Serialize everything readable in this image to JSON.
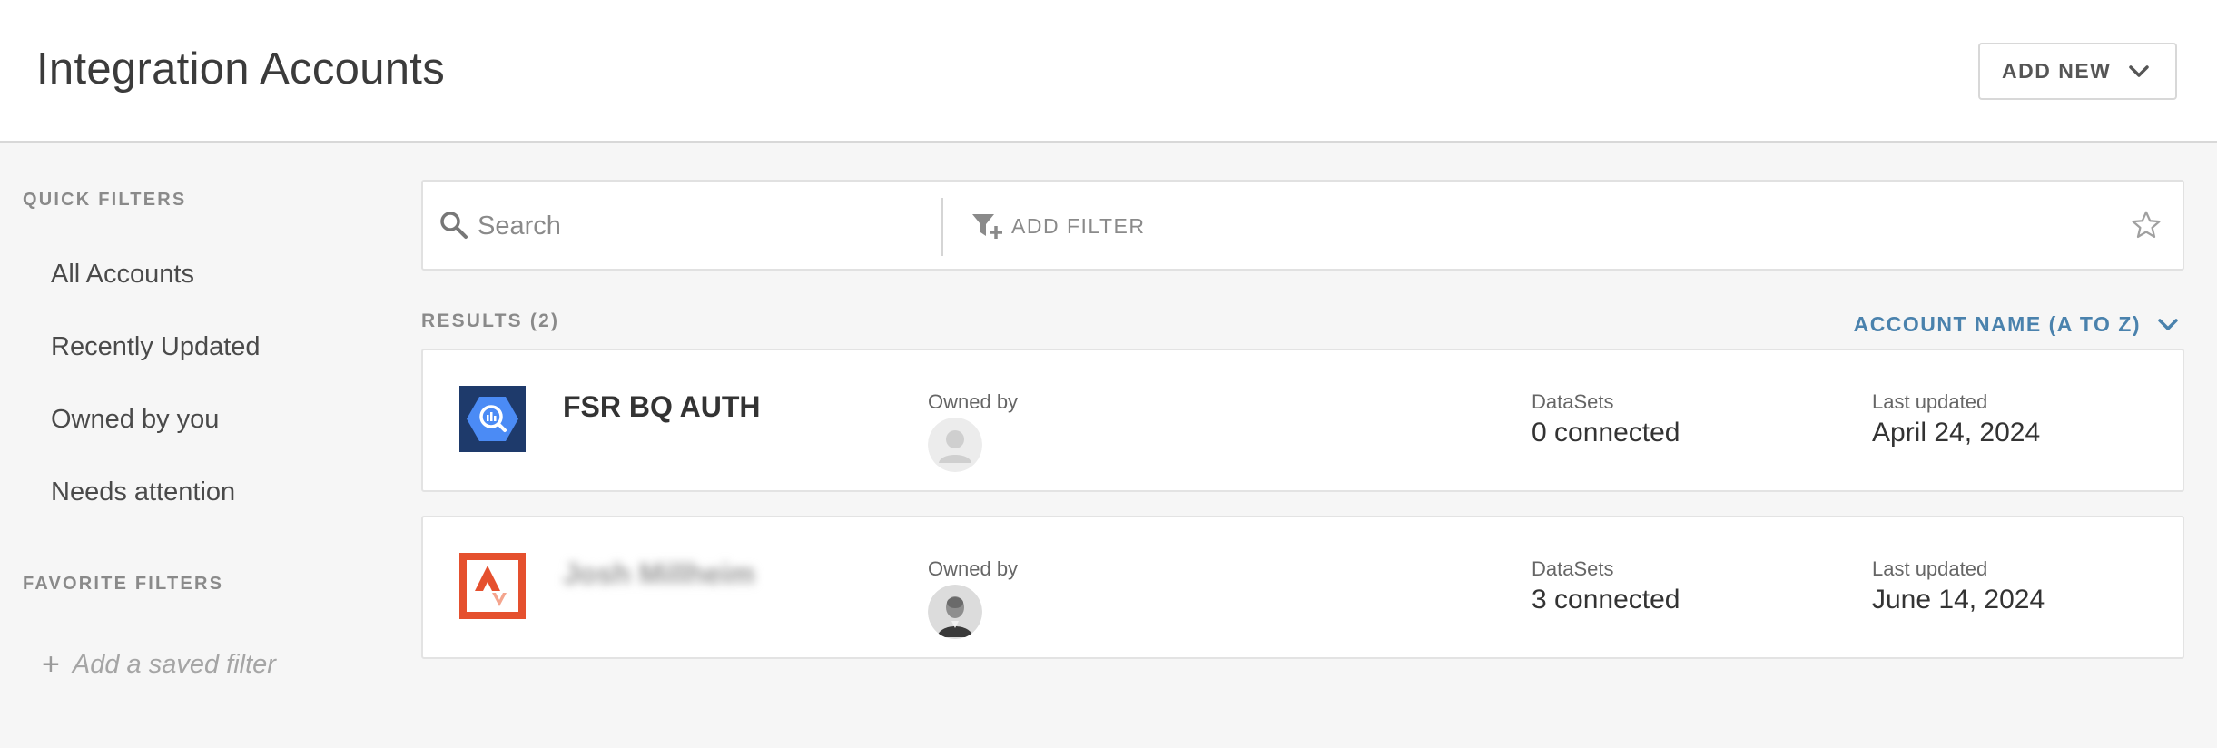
{
  "header": {
    "title": "Integration Accounts",
    "add_new_label": "ADD NEW"
  },
  "sidebar": {
    "quick_filters_label": "QUICK FILTERS",
    "quick_filters": [
      "All Accounts",
      "Recently Updated",
      "Owned by you",
      "Needs attention"
    ],
    "favorite_filters_label": "FAVORITE FILTERS",
    "add_saved_filter_label": "Add a saved filter"
  },
  "search": {
    "placeholder": "Search",
    "add_filter_label": "ADD FILTER"
  },
  "results": {
    "label": "RESULTS (2)",
    "sort_label": "ACCOUNT NAME (A TO Z)"
  },
  "accounts": [
    {
      "name": "FSR BQ AUTH",
      "logo_icon": "bigquery-icon",
      "owned_by_label": "Owned by",
      "owner_avatar": "default-user-avatar",
      "datasets_label": "DataSets",
      "datasets_value": "0 connected",
      "last_updated_label": "Last updated",
      "last_updated_value": "April 24, 2024"
    },
    {
      "name": "Josh Millheim",
      "logo_icon": "strava-icon",
      "owned_by_label": "Owned by",
      "owner_avatar": "user-photo-avatar",
      "datasets_label": "DataSets",
      "datasets_value": "3 connected",
      "last_updated_label": "Last updated",
      "last_updated_value": "June 14, 2024"
    }
  ],
  "colors": {
    "accent": "#4a82ad",
    "bigquery_bg": "#1e3a6b",
    "bigquery_hex": "#4b8bf5",
    "strava": "#e5502e"
  }
}
